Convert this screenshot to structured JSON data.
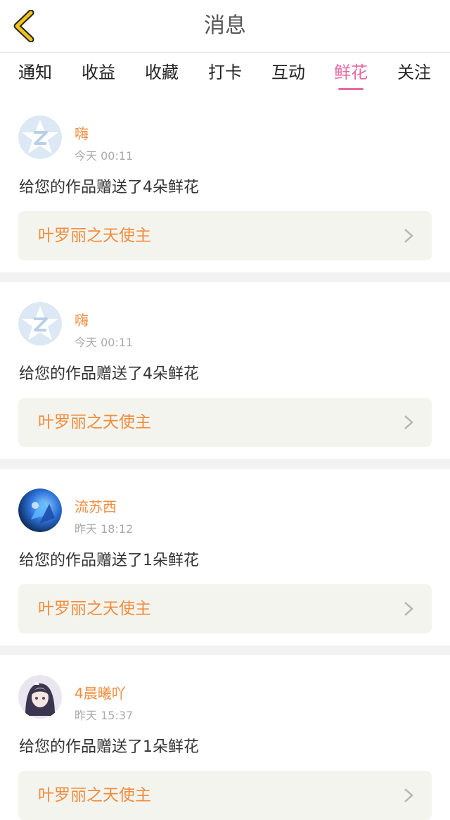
{
  "header": {
    "title": "消息"
  },
  "tabs": [
    "通知",
    "收益",
    "收藏",
    "打卡",
    "互动",
    "鲜花",
    "关注"
  ],
  "active_tab": "鲜花",
  "colors": {
    "accent_pink": "#e86aa4",
    "accent_orange": "#f08c3c"
  },
  "messages": [
    {
      "name": "嗨",
      "time": "今天 00:11",
      "text": "给您的作品赠送了4朵鲜花",
      "work": "叶罗丽之天使主",
      "avatar": "default-qq-avatar"
    },
    {
      "name": "嗨",
      "time": "今天 00:11",
      "text": "给您的作品赠送了4朵鲜花",
      "work": "叶罗丽之天使主",
      "avatar": "default-qq-avatar"
    },
    {
      "name": "流苏西",
      "time": "昨天 18:12",
      "text": "给您的作品赠送了1朵鲜花",
      "work": "叶罗丽之天使主",
      "avatar": "blue-abstract-avatar"
    },
    {
      "name": "4晨曦吖",
      "time": "昨天 15:37",
      "text": "给您的作品赠送了1朵鲜花",
      "work": "叶罗丽之天使主",
      "avatar": "anime-girl-avatar"
    }
  ]
}
